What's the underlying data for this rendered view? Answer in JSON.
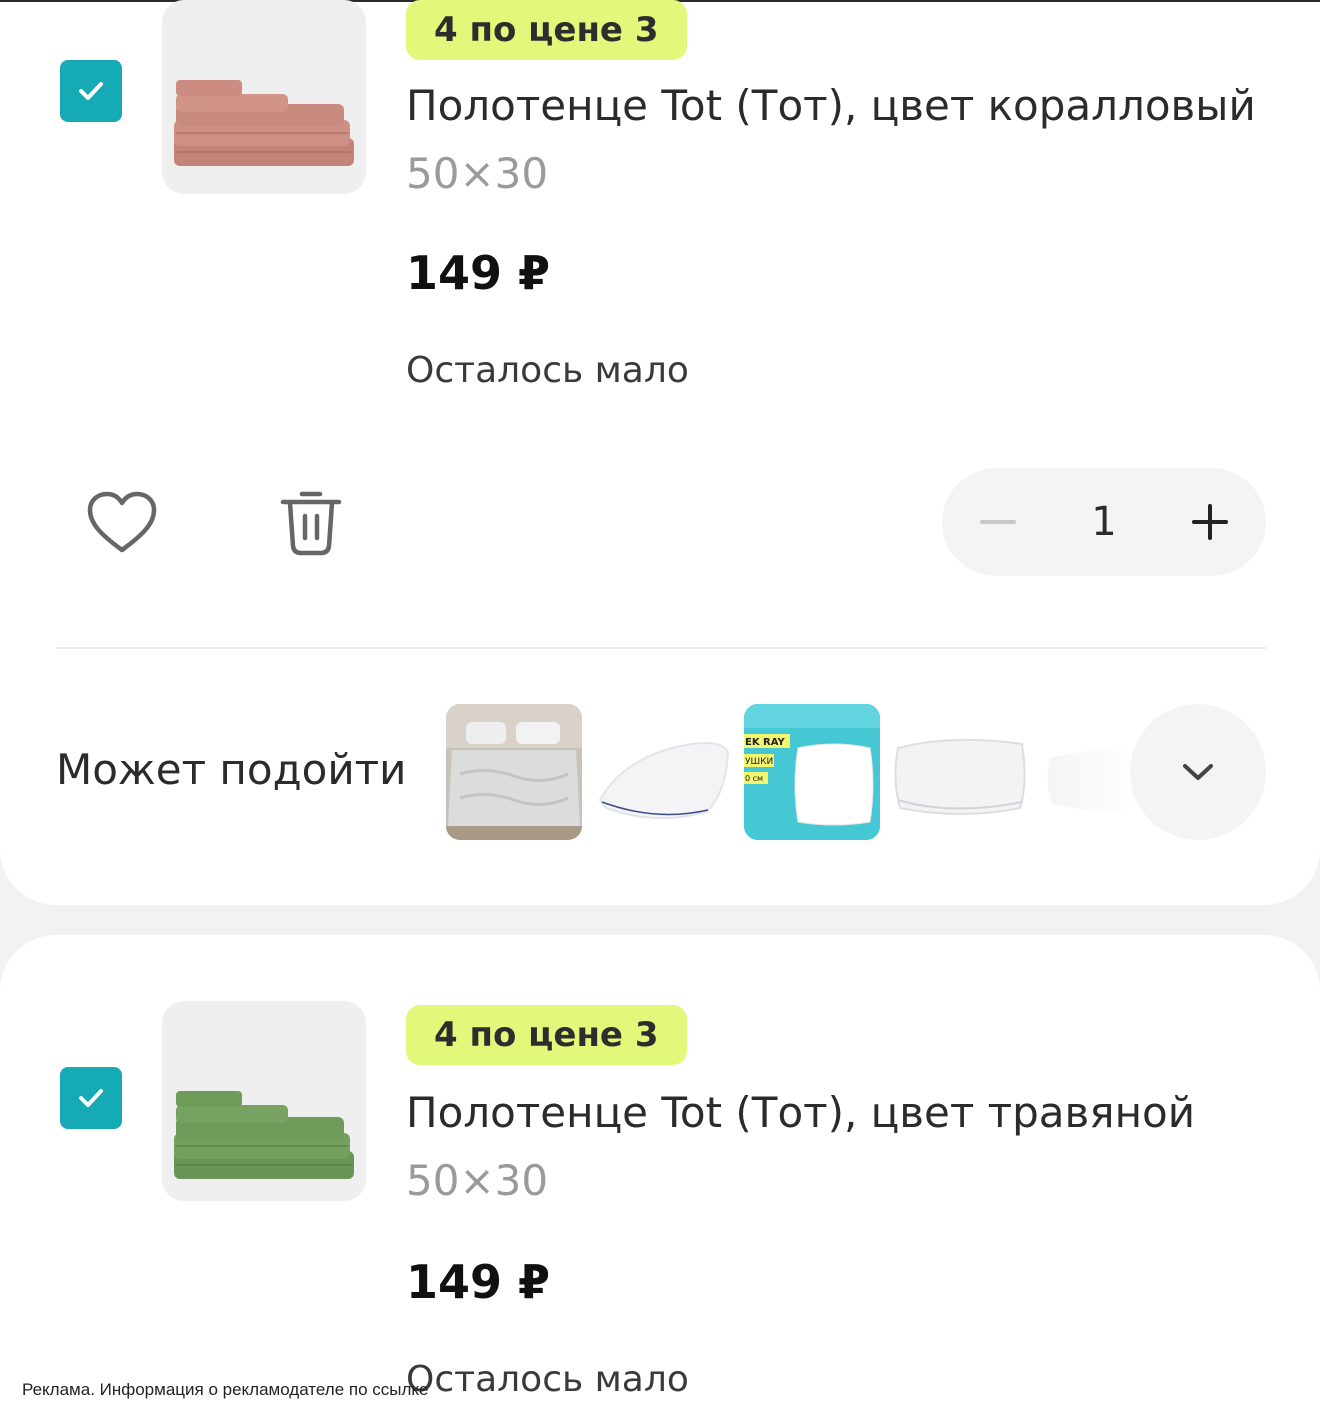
{
  "items": [
    {
      "badge": "4 по цене 3",
      "title": "Полотенце Tot (Тот), цвет коралловый",
      "size": "50×30",
      "price": "149 ₽",
      "stock": "Осталось мало",
      "quantity": "1",
      "checked": true,
      "color": "#c98a80"
    },
    {
      "badge": "4 по цене 3",
      "title": "Полотенце Tot (Тот), цвет травяной",
      "size": "50×30",
      "price": "149 ₽",
      "stock": "Осталось мало",
      "checked": true,
      "color": "#6e9a5a"
    }
  ],
  "suggestions": {
    "label": "Может подойти",
    "thumb3_text": [
      "EK RAY",
      "УШКИ",
      "0 см"
    ]
  },
  "ad_notice": "Реклама. Информация о рекламодателе по ссылке",
  "colors": {
    "checkbox": "#16aab4",
    "badge": "#e2f87a"
  }
}
